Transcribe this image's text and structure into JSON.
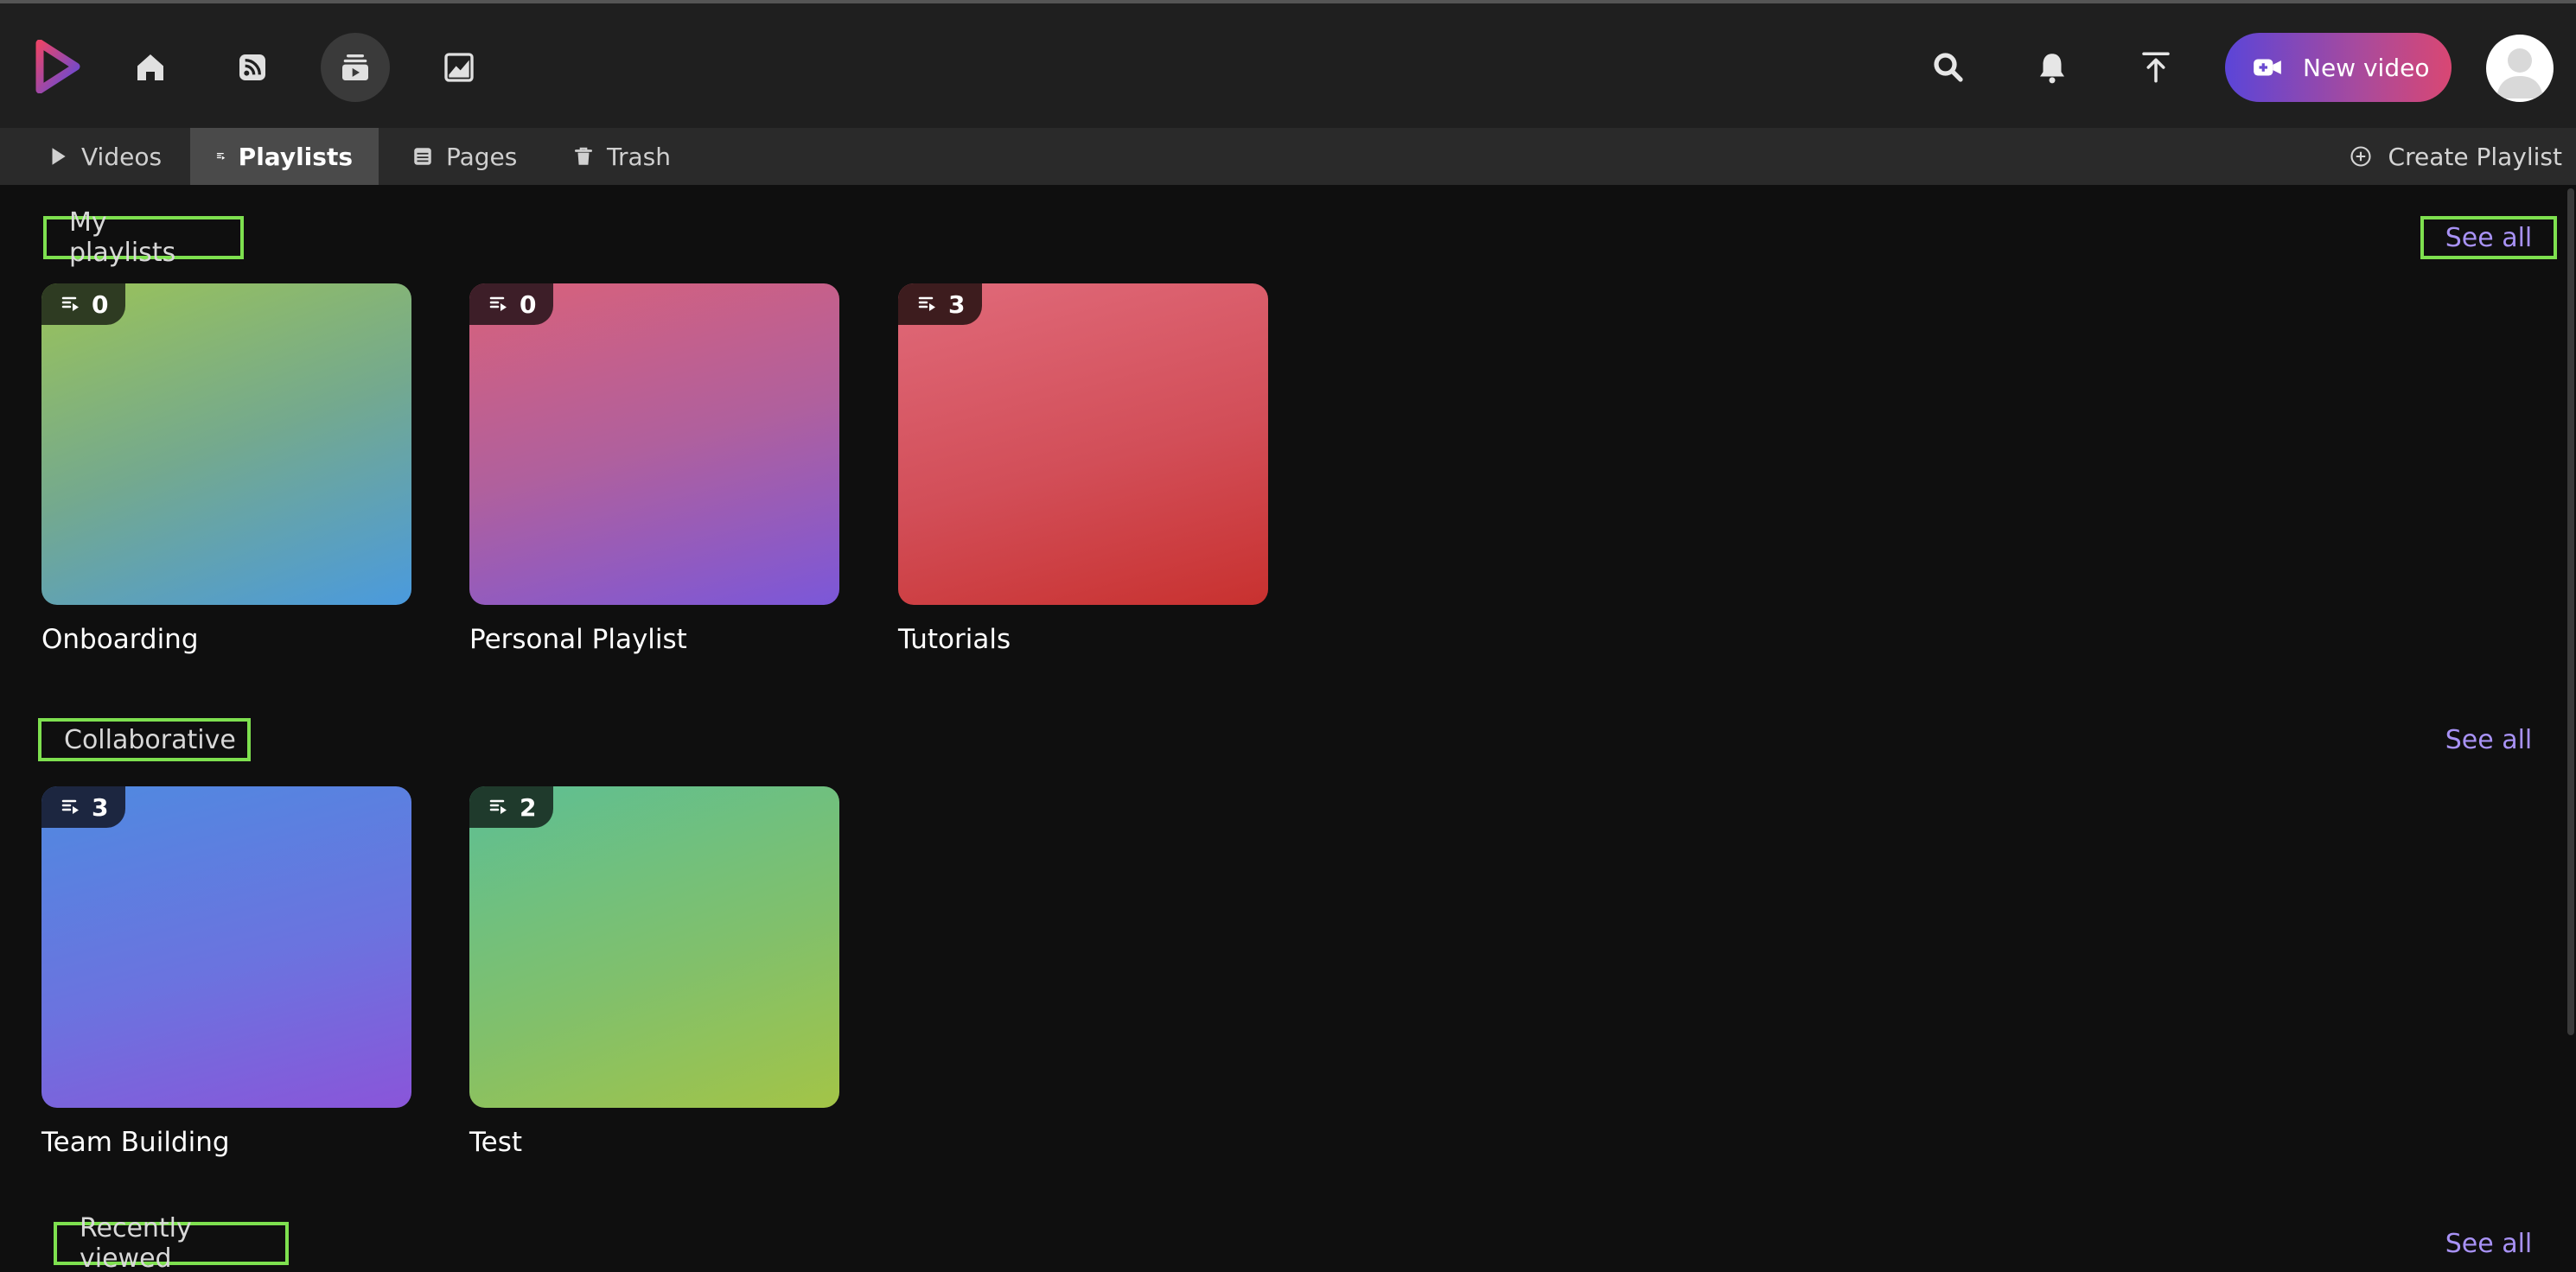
{
  "nav": {
    "icons": [
      "home-icon",
      "feed-icon",
      "library-icon",
      "analytics-icon"
    ],
    "active": "library-icon"
  },
  "header": {
    "new_video_label": "New video",
    "right_icons": [
      "search-icon",
      "bell-icon",
      "upload-icon"
    ]
  },
  "tabs": [
    {
      "label": "Videos",
      "icon": "play-icon"
    },
    {
      "label": "Playlists",
      "icon": "playlist-icon",
      "active": true
    },
    {
      "label": "Pages",
      "icon": "pages-icon"
    },
    {
      "label": "Trash",
      "icon": "trash-icon"
    }
  ],
  "create_playlist_label": "Create Playlist",
  "sections": {
    "my_playlists": {
      "title": "My playlists",
      "see_all": "See all",
      "items": [
        {
          "title": "Onboarding",
          "count": "0"
        },
        {
          "title": "Personal Playlist",
          "count": "0"
        },
        {
          "title": "Tutorials",
          "count": "3"
        }
      ]
    },
    "collaborative": {
      "title": "Collaborative",
      "see_all": "See all",
      "items": [
        {
          "title": "Team Building",
          "count": "3"
        },
        {
          "title": "Test",
          "count": "2"
        }
      ]
    },
    "recently_viewed": {
      "title": "Recently viewed",
      "see_all": "See all"
    }
  },
  "colors": {
    "accent": "#a892f5",
    "highlight_box": "#7ee04f",
    "topbar": "#1f1f1f",
    "subnav": "#2a2a2a",
    "background": "#0f0f0f"
  }
}
